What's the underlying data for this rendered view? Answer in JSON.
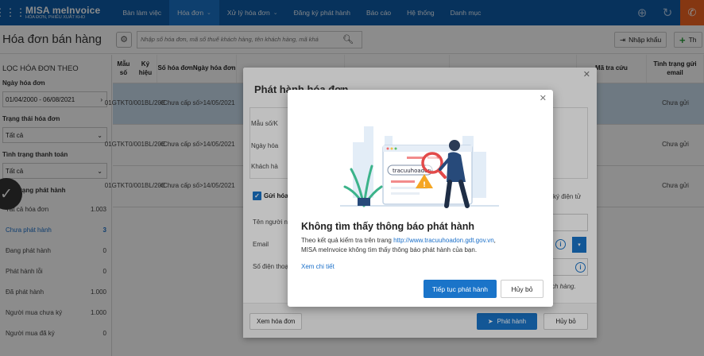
{
  "topbar": {
    "logo_line1": "MISA meInvoice",
    "logo_line2": "HÓA ĐƠN, PHIẾU XUẤT KHO",
    "nav": [
      {
        "label": "Bàn làm việc",
        "chevron": false
      },
      {
        "label": "Hóa đơn",
        "chevron": true
      },
      {
        "label": "Xử lý hóa đơn",
        "chevron": true
      },
      {
        "label": "Đăng ký phát hành",
        "chevron": false
      },
      {
        "label": "Báo cáo",
        "chevron": false
      },
      {
        "label": "Hệ thống",
        "chevron": false
      },
      {
        "label": "Danh mục",
        "chevron": false
      }
    ],
    "icons": [
      "add-circle-icon",
      "refresh-icon",
      "phone-icon"
    ],
    "accent": "#0d5ca8",
    "phone_color": "#f26522"
  },
  "subbar": {
    "page_title": "Hóa đơn bán hàng",
    "search_placeholder": "Nhập số hóa đơn, mã số thuế khách hàng, tên khách hàng, mã khá",
    "import_label": "Nhập khẩu",
    "add_label": "Th"
  },
  "sidebar": {
    "heading": "LỌC HÓA ĐƠN THEO",
    "date_label": "Ngày hóa đơn",
    "date_value": "01/04/2000 - 06/08/2021",
    "status_label": "Trạng thái hóa đơn",
    "status_value": "Tất cả",
    "payment_label": "Tình trạng thanh toán",
    "payment_value": "Tất cả",
    "issue_label": "Tình trạng phát hành",
    "items": [
      {
        "label": "Tất cả hóa đơn",
        "count": "1.003",
        "active": false
      },
      {
        "label": "Chưa phát hành",
        "count": "3",
        "active": true
      },
      {
        "label": "Đang phát hành",
        "count": "0",
        "active": false
      },
      {
        "label": "Phát hành lỗi",
        "count": "0",
        "active": false
      },
      {
        "label": "Đã phát hành",
        "count": "1.000",
        "active": false
      },
      {
        "label": "Người mua chưa ký",
        "count": "1.000",
        "active": false
      },
      {
        "label": "Người mua đã ký",
        "count": "0",
        "active": false
      }
    ]
  },
  "table": {
    "headers": [
      {
        "l1": "Mẫu số",
        "l2": "Ký hiệu"
      },
      {
        "l1": "Số hóa đơn",
        "l2": "Ngày hóa đơn"
      },
      {
        "l1": "",
        "l2": ""
      },
      {
        "l1": "",
        "l2": ""
      },
      {
        "l1": "",
        "l2": ""
      },
      {
        "l1": "Mã tra cứu",
        "l2": ""
      },
      {
        "l1": "Tình trạng gửi email",
        "l2": ""
      }
    ],
    "rows": [
      {
        "mau_so": "01GTKT0/001",
        "ky_hieu": "BL/20E",
        "so_hd": "<Chưa cấp số>",
        "ngay": "14/05/2021",
        "trang_thai": "Chưa gửi"
      },
      {
        "mau_so": "01GTKT0/001",
        "ky_hieu": "BL/20E",
        "so_hd": "<Chưa cấp số>",
        "ngay": "14/05/2021",
        "trang_thai": "Chưa gửi"
      },
      {
        "mau_so": "01GTKT0/001",
        "ky_hieu": "BL/20E",
        "so_hd": "<Chưa cấp số>",
        "ngay": "14/05/2021",
        "trang_thai": "Chưa gửi"
      }
    ]
  },
  "issue_dialog": {
    "title": "Phát hành hóa đơn",
    "info_labels": [
      "Mẫu số/K",
      "Ngày hóa",
      "Khách hà"
    ],
    "send_checkbox_label": "Gửi hóa",
    "signature_text": "i ký điện tử",
    "name_label": "Tên người n",
    "email_label": "Email",
    "phone_label": "Số điện thoạ",
    "note_text": "ch hàng.",
    "view_button": "Xem hóa đơn",
    "issue_button": "Phát hành",
    "cancel_button": "Hủy bỏ"
  },
  "notice_dialog": {
    "illus_search_text": "tracuuhoadon",
    "heading": "Không tìm thấy thông báo phát hành",
    "msg_prefix": "Theo kết quả kiểm tra trên trang ",
    "msg_link": "http://www.tracuuhoadon.gdt.gov.vn",
    "msg_suffix": ",",
    "msg_line2": "MISA meInvoice không tìm thấy thông báo phát hành của bạn.",
    "detail_link": "Xem chi tiết",
    "continue_button": "Tiếp tục phát hành",
    "cancel_button": "Hủy bỏ"
  }
}
